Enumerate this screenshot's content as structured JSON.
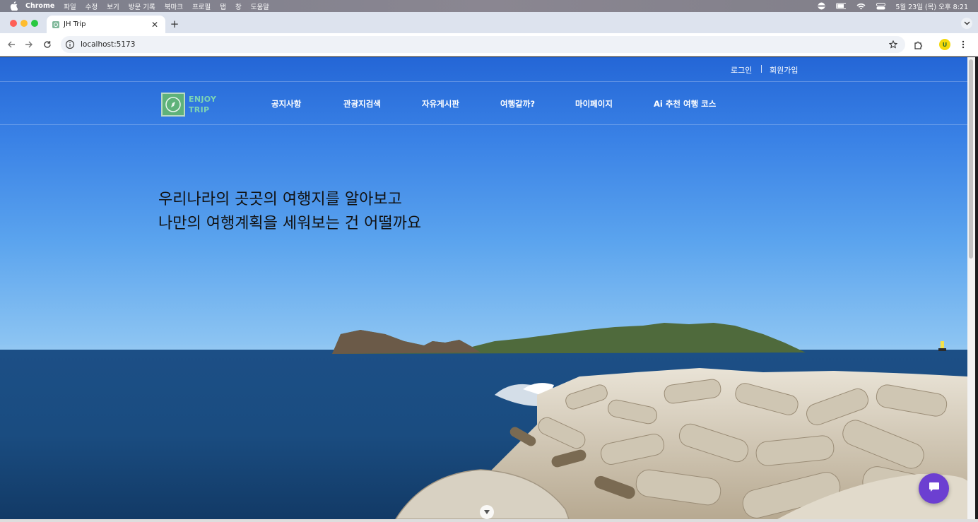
{
  "menubar": {
    "app": "Chrome",
    "items": [
      "파일",
      "수정",
      "보기",
      "방문 기록",
      "북마크",
      "프로필",
      "탭",
      "창",
      "도움말"
    ],
    "clock": "5월 23일 (목) 오후 8:21"
  },
  "browser": {
    "tab_title": "JH Trip",
    "url": "localhost:5173",
    "profile_initial": "U"
  },
  "page": {
    "util_links": [
      "로그인",
      "회원가입"
    ],
    "logo_lines": [
      "ENJOY",
      "TRIP"
    ],
    "nav": [
      "공지사항",
      "관광지검색",
      "자유게시판",
      "여행갈까?",
      "마이페이지",
      "Ai 추천 여행 코스"
    ],
    "hero_lines": [
      "우리나라의 곳곳의 여행지를 알아보고",
      "나만의 여행계획을 세워보는 건 어떨까요"
    ]
  },
  "colors": {
    "chat_button": "#6c3fd1",
    "logo_mark": "#5fb27a",
    "logo_text": "#7dd4b4"
  }
}
